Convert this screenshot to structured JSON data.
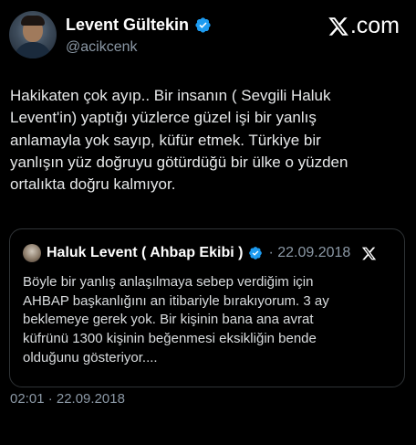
{
  "author": {
    "display_name": "Levent Gültekin",
    "handle": "@acikcenk",
    "verified_icon": "verified-badge-icon",
    "avatar": "profile-photo"
  },
  "brand": {
    "logo_icon": "x-logo-icon",
    "logo_text": ".com"
  },
  "tweet": {
    "text": "Hakikaten çok ayıp.. Bir insanın ( Sevgili Haluk\nLevent'in) yaptığı yüzlerce güzel işi bir yanlış\nanlamayla yok sayıp, küfür etmek. Türkiye bir\nyanlışın yüz doğruyu götürdüğü bir ülke o yüzden\nortalıkta doğru kalmıyor.",
    "timestamp": "02:01 · 22.09.2018"
  },
  "quoted_tweet": {
    "display_name": "Haluk Levent ( Ahbap Ekibi )",
    "date": "· 22.09.2018",
    "text": "Böyle bir yanlış anlaşılmaya sebep verdiğim için\nAHBAP başkanlığını an itibariyle bırakıyorum. 3 ay\nbeklemeye gerek yok. Bir kişinin bana ana avrat\nküfrünü 1300 kişinin beğenmesi eksikliğin bende\nolduğunu gösteriyor...."
  },
  "colors": {
    "background": "#000000",
    "text": "#e7e9ea",
    "secondary": "#8b98a5",
    "verified": "#1d9bf0",
    "border": "#2f3336"
  }
}
